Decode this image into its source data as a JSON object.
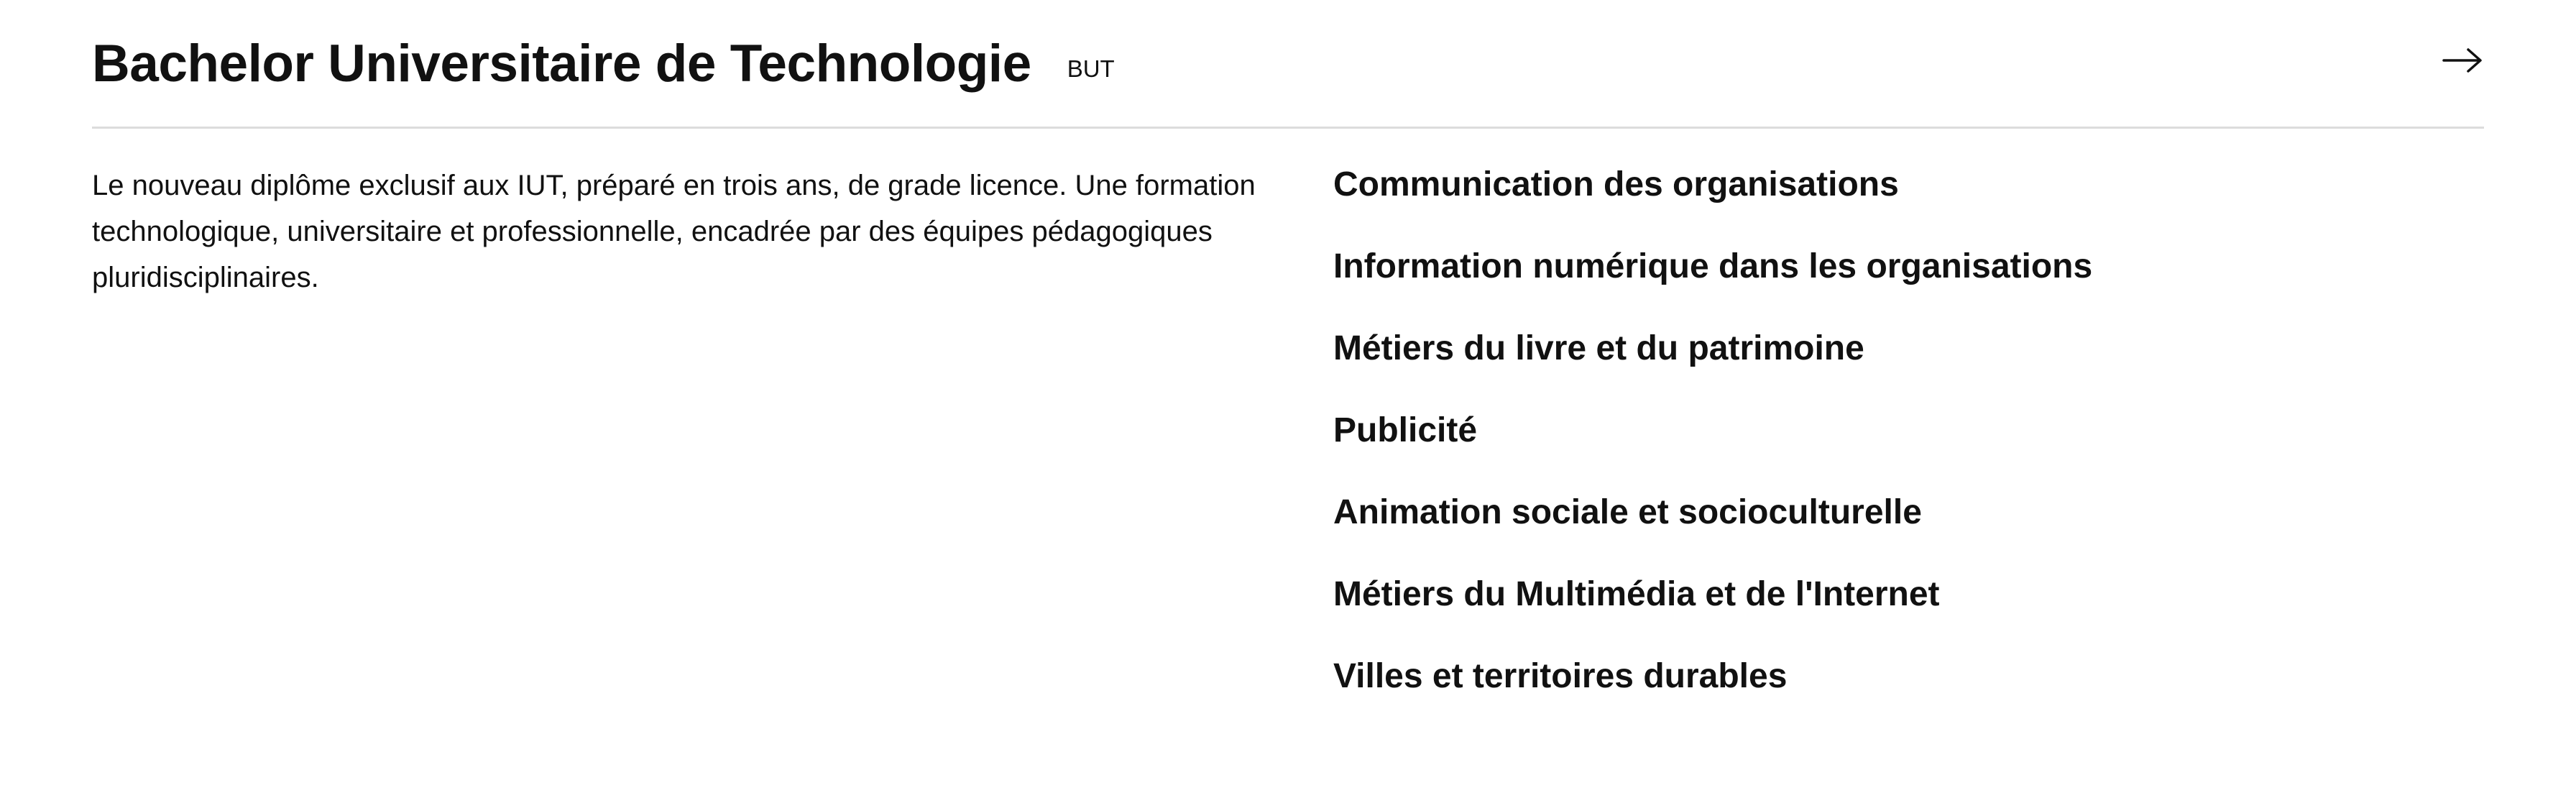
{
  "header": {
    "title": "Bachelor Universitaire de Technologie",
    "badge": "BUT",
    "arrow_icon": "arrow-right-icon"
  },
  "description": "Le nouveau diplôme exclusif aux IUT, préparé en trois ans, de grade licence. Une formation technologique, universitaire et professionnelle, encadrée par des équipes pédagogiques pluridisciplinaires.",
  "programs": [
    {
      "label": "Communication des organisations"
    },
    {
      "label": "Information numérique dans les organisations"
    },
    {
      "label": "Métiers du livre et du patrimoine"
    },
    {
      "label": "Publicité"
    },
    {
      "label": "Animation sociale et socioculturelle"
    },
    {
      "label": "Métiers du Multimédia et de l'Internet"
    },
    {
      "label": "Villes et territoires durables"
    }
  ],
  "colors": {
    "text": "#111111",
    "divider": "#dcdcdc",
    "background": "#ffffff"
  }
}
